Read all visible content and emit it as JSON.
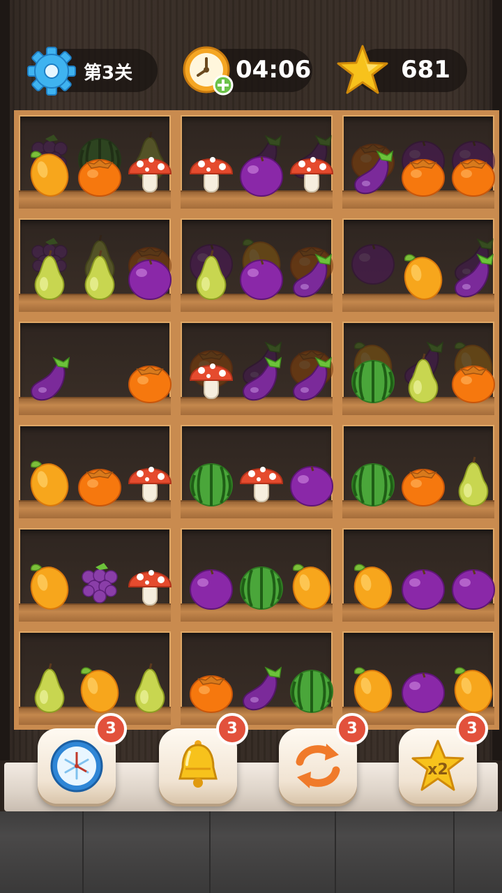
{
  "hud": {
    "level_label": "第3关",
    "timer": "04:06",
    "score": "681"
  },
  "colors": {
    "frame": "#c98b4f",
    "badge": "#e2513c",
    "gear": "#3fb3f0",
    "star": "#f7c21c"
  },
  "shelves": [
    {
      "front": [
        "mango",
        "persimmon",
        "mushroom"
      ],
      "back": [
        "grape",
        "watermelon",
        "pear"
      ]
    },
    {
      "front": [
        "mushroom",
        "plum",
        "mushroom"
      ],
      "back": [
        "",
        "eggplant",
        "eggplant"
      ]
    },
    {
      "front": [
        "eggplant",
        "persimmon",
        "persimmon"
      ],
      "back": [
        "persimmon",
        "plum",
        "plum"
      ]
    },
    {
      "front": [
        "pear",
        "pear",
        "plum"
      ],
      "back": [
        "grape",
        "pear",
        "persimmon"
      ]
    },
    {
      "front": [
        "pear",
        "plum",
        "eggplant"
      ],
      "back": [
        "plum",
        "mango",
        "persimmon"
      ]
    },
    {
      "front": [
        "",
        "mango",
        "eggplant"
      ],
      "back": [
        "plum",
        "",
        "eggplant"
      ]
    },
    {
      "front": [
        "eggplant",
        "",
        "persimmon"
      ],
      "back": [
        "",
        "",
        ""
      ]
    },
    {
      "front": [
        "mushroom",
        "eggplant",
        "eggplant"
      ],
      "back": [
        "persimmon",
        "eggplant",
        "persimmon"
      ]
    },
    {
      "front": [
        "watermelon",
        "pear",
        "persimmon"
      ],
      "back": [
        "mango",
        "eggplant",
        "mango"
      ]
    },
    {
      "front": [
        "mango",
        "persimmon",
        "mushroom"
      ],
      "back": [
        "",
        "",
        ""
      ]
    },
    {
      "front": [
        "watermelon",
        "mushroom",
        "plum"
      ],
      "back": [
        "",
        "",
        ""
      ]
    },
    {
      "front": [
        "watermelon",
        "persimmon",
        "pear"
      ],
      "back": [
        "",
        "",
        ""
      ]
    },
    {
      "front": [
        "mango",
        "grape",
        "mushroom"
      ],
      "back": [
        "",
        "",
        ""
      ]
    },
    {
      "front": [
        "plum",
        "watermelon",
        "mango"
      ],
      "back": [
        "",
        "",
        ""
      ]
    },
    {
      "front": [
        "mango",
        "plum",
        "plum"
      ],
      "back": [
        "",
        "",
        ""
      ]
    },
    {
      "front": [
        "pear",
        "mango",
        "pear"
      ],
      "back": [
        "",
        "",
        ""
      ]
    },
    {
      "front": [
        "persimmon",
        "eggplant",
        "watermelon"
      ],
      "back": [
        "",
        "",
        ""
      ]
    },
    {
      "front": [
        "mango",
        "plum",
        "mango"
      ],
      "back": [
        "",
        "",
        ""
      ]
    }
  ],
  "powerups": [
    {
      "name": "freeze-clock-icon",
      "count": "3"
    },
    {
      "name": "bell-icon",
      "count": "3"
    },
    {
      "name": "shuffle-icon",
      "count": "3"
    },
    {
      "name": "star-x2-icon",
      "count": "3",
      "label": "x2"
    }
  ]
}
